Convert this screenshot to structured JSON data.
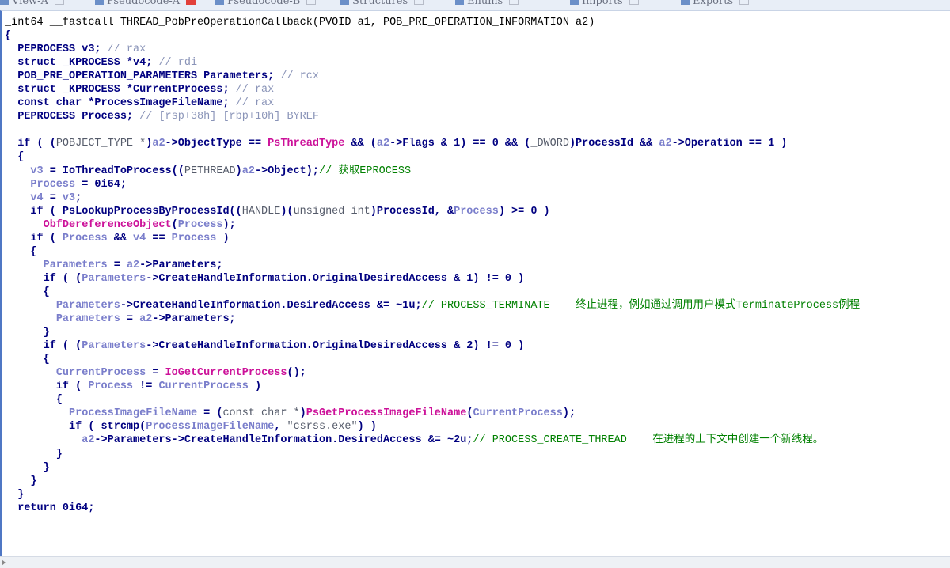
{
  "tabs": [
    {
      "label": "View-A",
      "active": false
    },
    {
      "label": "Pseudocode-A",
      "active": true
    },
    {
      "label": "Pseudocode-B",
      "active": false
    },
    {
      "label": "Structures",
      "active": false
    },
    {
      "label": "Enums",
      "active": false
    },
    {
      "label": "Imports",
      "active": false
    },
    {
      "label": "Exports",
      "active": false
    }
  ],
  "code": {
    "signature": "_int64 __fastcall THREAD_PobPreOperationCallback(PVOID a1, POB_PRE_OPERATION_INFORMATION a2)",
    "lines": [
      [
        [
          "{",
          "plain"
        ]
      ],
      [
        [
          "  PEPROCESS v3; ",
          "plain"
        ],
        [
          "// rax",
          "cmv"
        ]
      ],
      [
        [
          "  struct _KPROCESS *v4; ",
          "plain"
        ],
        [
          "// rdi",
          "cmv"
        ]
      ],
      [
        [
          "  POB_PRE_OPERATION_PARAMETERS Parameters; ",
          "plain"
        ],
        [
          "// rcx",
          "cmv"
        ]
      ],
      [
        [
          "  struct _KPROCESS *CurrentProcess; ",
          "plain"
        ],
        [
          "// rax",
          "cmv"
        ]
      ],
      [
        [
          "  const char *ProcessImageFileName; ",
          "plain"
        ],
        [
          "// rax",
          "cmv"
        ]
      ],
      [
        [
          "  PEPROCESS Process; ",
          "plain"
        ],
        [
          "// [rsp+38h] [rbp+10h] BYREF",
          "cmv"
        ]
      ],
      [
        [
          "",
          "plain"
        ]
      ],
      [
        [
          "  if ( (",
          "plain"
        ],
        [
          "POBJECT_TYPE *",
          "type"
        ],
        [
          ")",
          "plain"
        ],
        [
          "a2",
          "var"
        ],
        [
          "->ObjectType == ",
          "plain"
        ],
        [
          "PsThreadType",
          "fn"
        ],
        [
          " && (",
          "plain"
        ],
        [
          "a2",
          "var"
        ],
        [
          "->Flags & 1) == 0 && (",
          "plain"
        ],
        [
          "_DWORD",
          "type"
        ],
        [
          ")ProcessId && ",
          "plain"
        ],
        [
          "a2",
          "var"
        ],
        [
          "->Operation == 1 )",
          "plain"
        ]
      ],
      [
        [
          "  {",
          "plain"
        ]
      ],
      [
        [
          "    ",
          "plain"
        ],
        [
          "v3",
          "var"
        ],
        [
          " = IoThreadToProcess((",
          "plain"
        ],
        [
          "PETHREAD",
          "type"
        ],
        [
          ")",
          "plain"
        ],
        [
          "a2",
          "var"
        ],
        [
          "->Object);",
          "plain"
        ],
        [
          "// 获取EPROCESS",
          "cm"
        ]
      ],
      [
        [
          "    ",
          "plain"
        ],
        [
          "Process",
          "var"
        ],
        [
          " = 0i64;",
          "plain"
        ]
      ],
      [
        [
          "    ",
          "plain"
        ],
        [
          "v4",
          "var"
        ],
        [
          " = ",
          "plain"
        ],
        [
          "v3",
          "var"
        ],
        [
          ";",
          "plain"
        ]
      ],
      [
        [
          "    if ( PsLookupProcessByProcessId((",
          "plain"
        ],
        [
          "HANDLE",
          "type"
        ],
        [
          ")(",
          "plain"
        ],
        [
          "unsigned int",
          "type"
        ],
        [
          ")ProcessId, &",
          "plain"
        ],
        [
          "Process",
          "var"
        ],
        [
          ") >= 0 )",
          "plain"
        ]
      ],
      [
        [
          "      ",
          "plain"
        ],
        [
          "ObfDereferenceObject",
          "fn"
        ],
        [
          "(",
          "plain"
        ],
        [
          "Process",
          "var"
        ],
        [
          ");",
          "plain"
        ]
      ],
      [
        [
          "    if ( ",
          "plain"
        ],
        [
          "Process",
          "var"
        ],
        [
          " && ",
          "plain"
        ],
        [
          "v4",
          "var"
        ],
        [
          " == ",
          "plain"
        ],
        [
          "Process",
          "var"
        ],
        [
          " )",
          "plain"
        ]
      ],
      [
        [
          "    {",
          "plain"
        ]
      ],
      [
        [
          "      ",
          "plain"
        ],
        [
          "Parameters",
          "var"
        ],
        [
          " = ",
          "plain"
        ],
        [
          "a2",
          "var"
        ],
        [
          "->Parameters;",
          "plain"
        ]
      ],
      [
        [
          "      if ( (",
          "plain"
        ],
        [
          "Parameters",
          "var"
        ],
        [
          "->CreateHandleInformation.OriginalDesiredAccess & 1) != 0 )",
          "plain"
        ]
      ],
      [
        [
          "      {",
          "plain"
        ]
      ],
      [
        [
          "        ",
          "plain"
        ],
        [
          "Parameters",
          "var"
        ],
        [
          "->CreateHandleInformation.DesiredAccess &= ~1u;",
          "plain"
        ],
        [
          "// PROCESS_TERMINATE    终止进程，例如通过调用用户模式TerminateProcess例程",
          "cm"
        ]
      ],
      [
        [
          "        ",
          "plain"
        ],
        [
          "Parameters",
          "var"
        ],
        [
          " = ",
          "plain"
        ],
        [
          "a2",
          "var"
        ],
        [
          "->Parameters;",
          "plain"
        ]
      ],
      [
        [
          "      }",
          "plain"
        ]
      ],
      [
        [
          "      if ( (",
          "plain"
        ],
        [
          "Parameters",
          "var"
        ],
        [
          "->CreateHandleInformation.OriginalDesiredAccess & 2) != 0 )",
          "plain"
        ]
      ],
      [
        [
          "      {",
          "plain"
        ]
      ],
      [
        [
          "        ",
          "plain"
        ],
        [
          "CurrentProcess",
          "var"
        ],
        [
          " = ",
          "plain"
        ],
        [
          "IoGetCurrentProcess",
          "fn"
        ],
        [
          "();",
          "plain"
        ]
      ],
      [
        [
          "        if ( ",
          "plain"
        ],
        [
          "Process",
          "var"
        ],
        [
          " != ",
          "plain"
        ],
        [
          "CurrentProcess",
          "var"
        ],
        [
          " )",
          "plain"
        ]
      ],
      [
        [
          "        {",
          "plain"
        ]
      ],
      [
        [
          "          ",
          "plain"
        ],
        [
          "ProcessImageFileName",
          "var"
        ],
        [
          " = (",
          "plain"
        ],
        [
          "const char *",
          "type"
        ],
        [
          ")",
          "plain"
        ],
        [
          "PsGetProcessImageFileName",
          "fn"
        ],
        [
          "(",
          "plain"
        ],
        [
          "CurrentProcess",
          "var"
        ],
        [
          ");",
          "plain"
        ]
      ],
      [
        [
          "          if ( strcmp(",
          "plain"
        ],
        [
          "ProcessImageFileName",
          "var"
        ],
        [
          ", ",
          "plain"
        ],
        [
          "\"csrss.exe\"",
          "type"
        ],
        [
          ") )",
          "plain"
        ]
      ],
      [
        [
          "            ",
          "plain"
        ],
        [
          "a2",
          "var"
        ],
        [
          "->Parameters->CreateHandleInformation.DesiredAccess &= ~2u;",
          "plain"
        ],
        [
          "// PROCESS_CREATE_THREAD    在进程的上下文中创建一个新线程。",
          "cm"
        ]
      ],
      [
        [
          "        }",
          "plain"
        ]
      ],
      [
        [
          "      }",
          "plain"
        ]
      ],
      [
        [
          "    }",
          "plain"
        ]
      ],
      [
        [
          "  }",
          "plain"
        ]
      ],
      [
        [
          "  return 0i64;",
          "plain"
        ]
      ]
    ]
  }
}
